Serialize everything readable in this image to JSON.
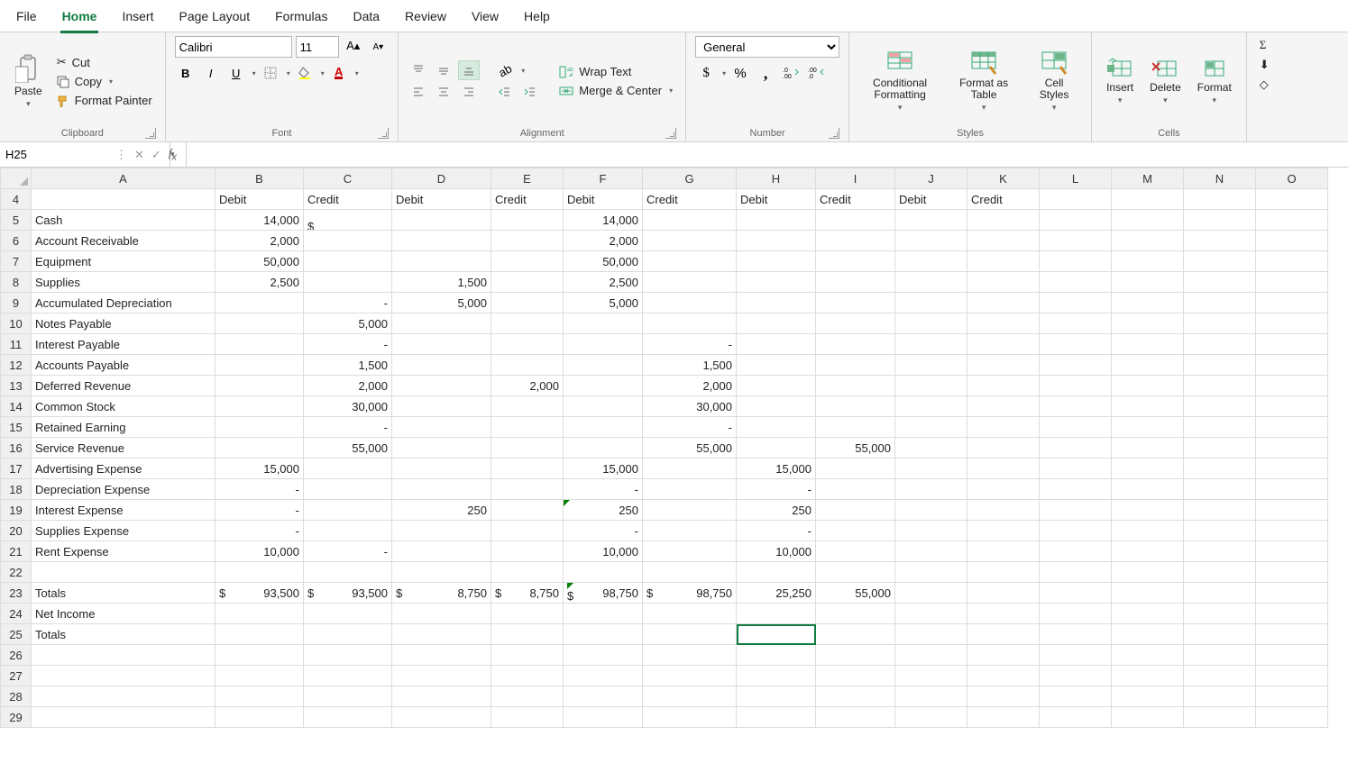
{
  "menu": {
    "items": [
      "File",
      "Home",
      "Insert",
      "Page Layout",
      "Formulas",
      "Data",
      "Review",
      "View",
      "Help"
    ],
    "active": 1
  },
  "ribbon": {
    "clipboard": {
      "label": "Clipboard",
      "paste": "Paste",
      "cut": "Cut",
      "copy": "Copy",
      "format_painter": "Format Painter"
    },
    "font": {
      "label": "Font",
      "name": "Calibri",
      "size": "11"
    },
    "alignment": {
      "label": "Alignment",
      "wrap": "Wrap Text",
      "merge": "Merge & Center"
    },
    "number": {
      "label": "Number",
      "format": "General"
    },
    "styles": {
      "label": "Styles",
      "cond": "Conditional Formatting",
      "table": "Format as Table",
      "cell": "Cell Styles"
    },
    "cells": {
      "label": "Cells",
      "insert": "Insert",
      "delete": "Delete",
      "format": "Format"
    }
  },
  "formula_bar": {
    "name_box": "H25",
    "formula": ""
  },
  "columns": [
    "A",
    "B",
    "C",
    "D",
    "E",
    "F",
    "G",
    "H",
    "I",
    "J",
    "K",
    "L",
    "M",
    "N",
    "O"
  ],
  "first_row": 4,
  "last_row": 29,
  "selected_cell": "H25",
  "rows": [
    {
      "r": 4,
      "A": "",
      "B": "Debit",
      "C": "Credit",
      "D": "Debit",
      "E": "Credit",
      "F": "Debit",
      "G": "Credit",
      "H": "Debit",
      "I": "Credit",
      "J": "Debit",
      "K": "Credit"
    },
    {
      "r": 5,
      "A": "Cash",
      "Bn": "14,000",
      "Ccur": "",
      "Fn": "14,000"
    },
    {
      "r": 6,
      "A": "Account Receivable",
      "Bn": "2,000",
      "Fn": "2,000"
    },
    {
      "r": 7,
      "A": "Equipment",
      "Bn": "50,000",
      "Fn": "50,000"
    },
    {
      "r": 8,
      "A": "Supplies",
      "Bn": "2,500",
      "Dn": "1,500",
      "Fn": "2,500"
    },
    {
      "r": 9,
      "A": "Accumulated Depreciation",
      "Cn": "-",
      "Dn": "5,000",
      "Fn": "5,000"
    },
    {
      "r": 10,
      "A": "Notes Payable",
      "Cn": "5,000"
    },
    {
      "r": 11,
      "A": "Interest Payable",
      "Cn": "-",
      "Gn": "-"
    },
    {
      "r": 12,
      "A": "Accounts Payable",
      "Cn": "1,500",
      "Gn": "1,500"
    },
    {
      "r": 13,
      "A": "Deferred Revenue",
      "Cn": "2,000",
      "En": "2,000",
      "Gn": "2,000"
    },
    {
      "r": 14,
      "A": "Common Stock",
      "Cn": "30,000",
      "Gn": "30,000"
    },
    {
      "r": 15,
      "A": "Retained Earning",
      "Cn": "-",
      "Gn": "-"
    },
    {
      "r": 16,
      "A": "Service Revenue",
      "Cn": "55,000",
      "Gn": "55,000",
      "In": "55,000"
    },
    {
      "r": 17,
      "A": "Advertising Expense",
      "Bn": "15,000",
      "Fn": "15,000",
      "Hn": "15,000"
    },
    {
      "r": 18,
      "A": "Depreciation Expense",
      "Bn": "-",
      "Fn": "-",
      "Hn": "-"
    },
    {
      "r": 19,
      "A": "Interest Expense",
      "Bn": "-",
      "Dn": "250",
      "Fn": "250",
      "Ftri": true,
      "Hn": "250"
    },
    {
      "r": 20,
      "A": "Supplies Expense",
      "Bn": "-",
      "Fn": "-",
      "Hn": "-"
    },
    {
      "r": 21,
      "A": "Rent Expense",
      "Bn": "10,000",
      "Cn": "-",
      "Fn": "10,000",
      "Hn": "10,000"
    },
    {
      "r": 22,
      "A": ""
    },
    {
      "r": 23,
      "A": "Totals",
      "totals": true,
      "Bcur": "93,500",
      "Ccur": "93,500",
      "Dcur": "8,750",
      "Ecur": "8,750",
      "Fcur": "98,750",
      "Ftri": true,
      "Gcur": "98,750",
      "Hn": "25,250",
      "In": "55,000"
    },
    {
      "r": 24,
      "A": "Net Income"
    },
    {
      "r": 25,
      "A": "Totals"
    },
    {
      "r": 26,
      "A": ""
    },
    {
      "r": 27,
      "A": ""
    },
    {
      "r": 28,
      "A": ""
    },
    {
      "r": 29,
      "A": ""
    }
  ]
}
